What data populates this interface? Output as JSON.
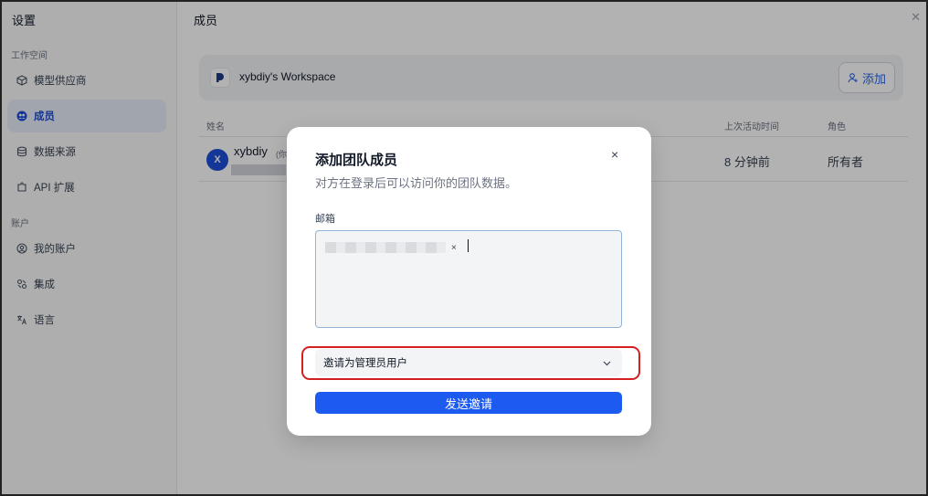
{
  "sidebar": {
    "title": "设置",
    "sections": [
      {
        "label": "工作空间",
        "items": [
          {
            "label": "模型供应商",
            "icon": "cube-icon",
            "active": false
          },
          {
            "label": "成员",
            "icon": "members-icon",
            "active": true
          },
          {
            "label": "数据来源",
            "icon": "database-icon",
            "active": false
          },
          {
            "label": "API 扩展",
            "icon": "puzzle-icon",
            "active": false
          }
        ]
      },
      {
        "label": "账户",
        "items": [
          {
            "label": "我的账户",
            "icon": "user-circle-icon",
            "active": false
          },
          {
            "label": "集成",
            "icon": "integration-icon",
            "active": false
          },
          {
            "label": "语言",
            "icon": "translate-icon",
            "active": false
          }
        ]
      }
    ]
  },
  "main": {
    "title": "成员",
    "workspace_name": "xybdiy's Workspace",
    "add_label": "添加",
    "columns": {
      "name": "姓名",
      "last_active": "上次活动时间",
      "role": "角色"
    },
    "members": [
      {
        "avatar": "X",
        "name": "xybdiy",
        "you_tag": "(你",
        "last_active": "8 分钟前",
        "role": "所有者"
      }
    ]
  },
  "modal": {
    "title": "添加团队成员",
    "close": "×",
    "subtitle": "对方在登录后可以访问你的团队数据。",
    "email_label": "邮箱",
    "chip_remove": "×",
    "role_select": "邀请为管理员用户",
    "send_label": "发送邀请"
  },
  "colors": {
    "accent": "#1d5bf0",
    "highlight": "#d32020"
  }
}
